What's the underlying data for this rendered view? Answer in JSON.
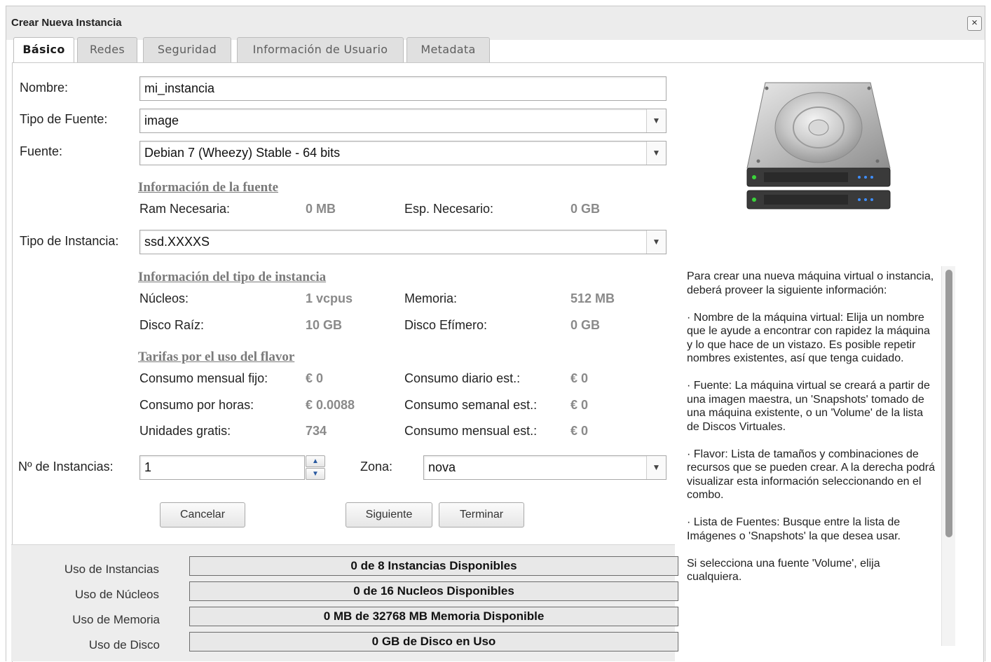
{
  "dialog": {
    "title": "Crear Nueva Instancia",
    "close_symbol": "×"
  },
  "tabs": [
    {
      "label": "Básico"
    },
    {
      "label": "Redes"
    },
    {
      "label": "Seguridad"
    },
    {
      "label": "Información de Usuario"
    },
    {
      "label": "Metadata"
    }
  ],
  "form": {
    "name_label": "Nombre:",
    "name_value": "mi_instancia",
    "source_type_label": "Tipo de Fuente:",
    "source_type_value": "image",
    "source_label": "Fuente:",
    "source_value": "Debian 7 (Wheezy) Stable - 64 bits",
    "instance_type_label": "Tipo de Instancia:",
    "instance_type_value": "ssd.XXXXS",
    "count_label": "Nº de Instancias:",
    "count_value": "1",
    "zone_label": "Zona:",
    "zone_value": "nova"
  },
  "source_info": {
    "heading": "Información de la fuente",
    "ram_label": "Ram Necesaria:",
    "ram_value": "0 MB",
    "disk_label": "Esp. Necesario:",
    "disk_value": "0 GB"
  },
  "flavor_info": {
    "heading": "Información del tipo de instancia",
    "cores_label": "Núcleos:",
    "cores_value": "1 vcpus",
    "memory_label": "Memoria:",
    "memory_value": "512 MB",
    "root_disk_label": "Disco Raíz:",
    "root_disk_value": "10 GB",
    "ephemeral_label": "Disco Efímero:",
    "ephemeral_value": "0 GB"
  },
  "rates": {
    "heading": "Tarifas por el uso del flavor",
    "monthly_fixed_label": "Consumo mensual fijo:",
    "monthly_fixed_value": "€ 0",
    "daily_est_label": "Consumo diario est.:",
    "daily_est_value": "€ 0",
    "hourly_label": "Consumo por horas:",
    "hourly_value": "€ 0.0088",
    "weekly_est_label": "Consumo semanal est.:",
    "weekly_est_value": "€ 0",
    "free_units_label": "Unidades gratis:",
    "free_units_value": "734",
    "monthly_est_label": "Consumo mensual est.:",
    "monthly_est_value": "€ 0"
  },
  "buttons": {
    "cancel": "Cancelar",
    "next": "Siguiente",
    "finish": "Terminar"
  },
  "usage": [
    {
      "label": "Uso de Instancias",
      "bar": "0 de 8 Instancias Disponibles"
    },
    {
      "label": "Uso de Núcleos",
      "bar": "0 de 16 Nucleos Disponibles"
    },
    {
      "label": "Uso de Memoria",
      "bar": "0 MB de 32768 MB Memoria Disponible"
    },
    {
      "label": "Uso de Disco",
      "bar": "0 GB de Disco en Uso"
    }
  ],
  "help": {
    "p1": "Para crear una nueva máquina virtual o instancia, deberá proveer la siguiente información:",
    "p2": "· Nombre de la máquina virtual: Elija un nombre que le ayude a encontrar con rapidez la máquina y lo que hace de un vistazo. Es posible repetir nombres existentes, así que tenga cuidado.",
    "p3": "· Fuente: La máquina virtual se creará a partir de una imagen maestra, un 'Snapshots' tomado de una máquina existente, o un 'Volume' de la lista de Discos Virtuales.",
    "p4": "· Flavor: Lista de tamaños y combinaciones de recursos que se pueden crear. A la derecha podrá visualizar esta información seleccionando en el combo.",
    "p5": "· Lista de Fuentes: Busque entre la lista de Imágenes o 'Snapshots' la que desea usar.",
    "p6": "Si selecciona una fuente 'Volume', elija cualquiera."
  },
  "icons": {
    "hard_drive": "hard-drive-icon",
    "select_arrow": "chevron-down-icon",
    "close": "close-icon"
  }
}
